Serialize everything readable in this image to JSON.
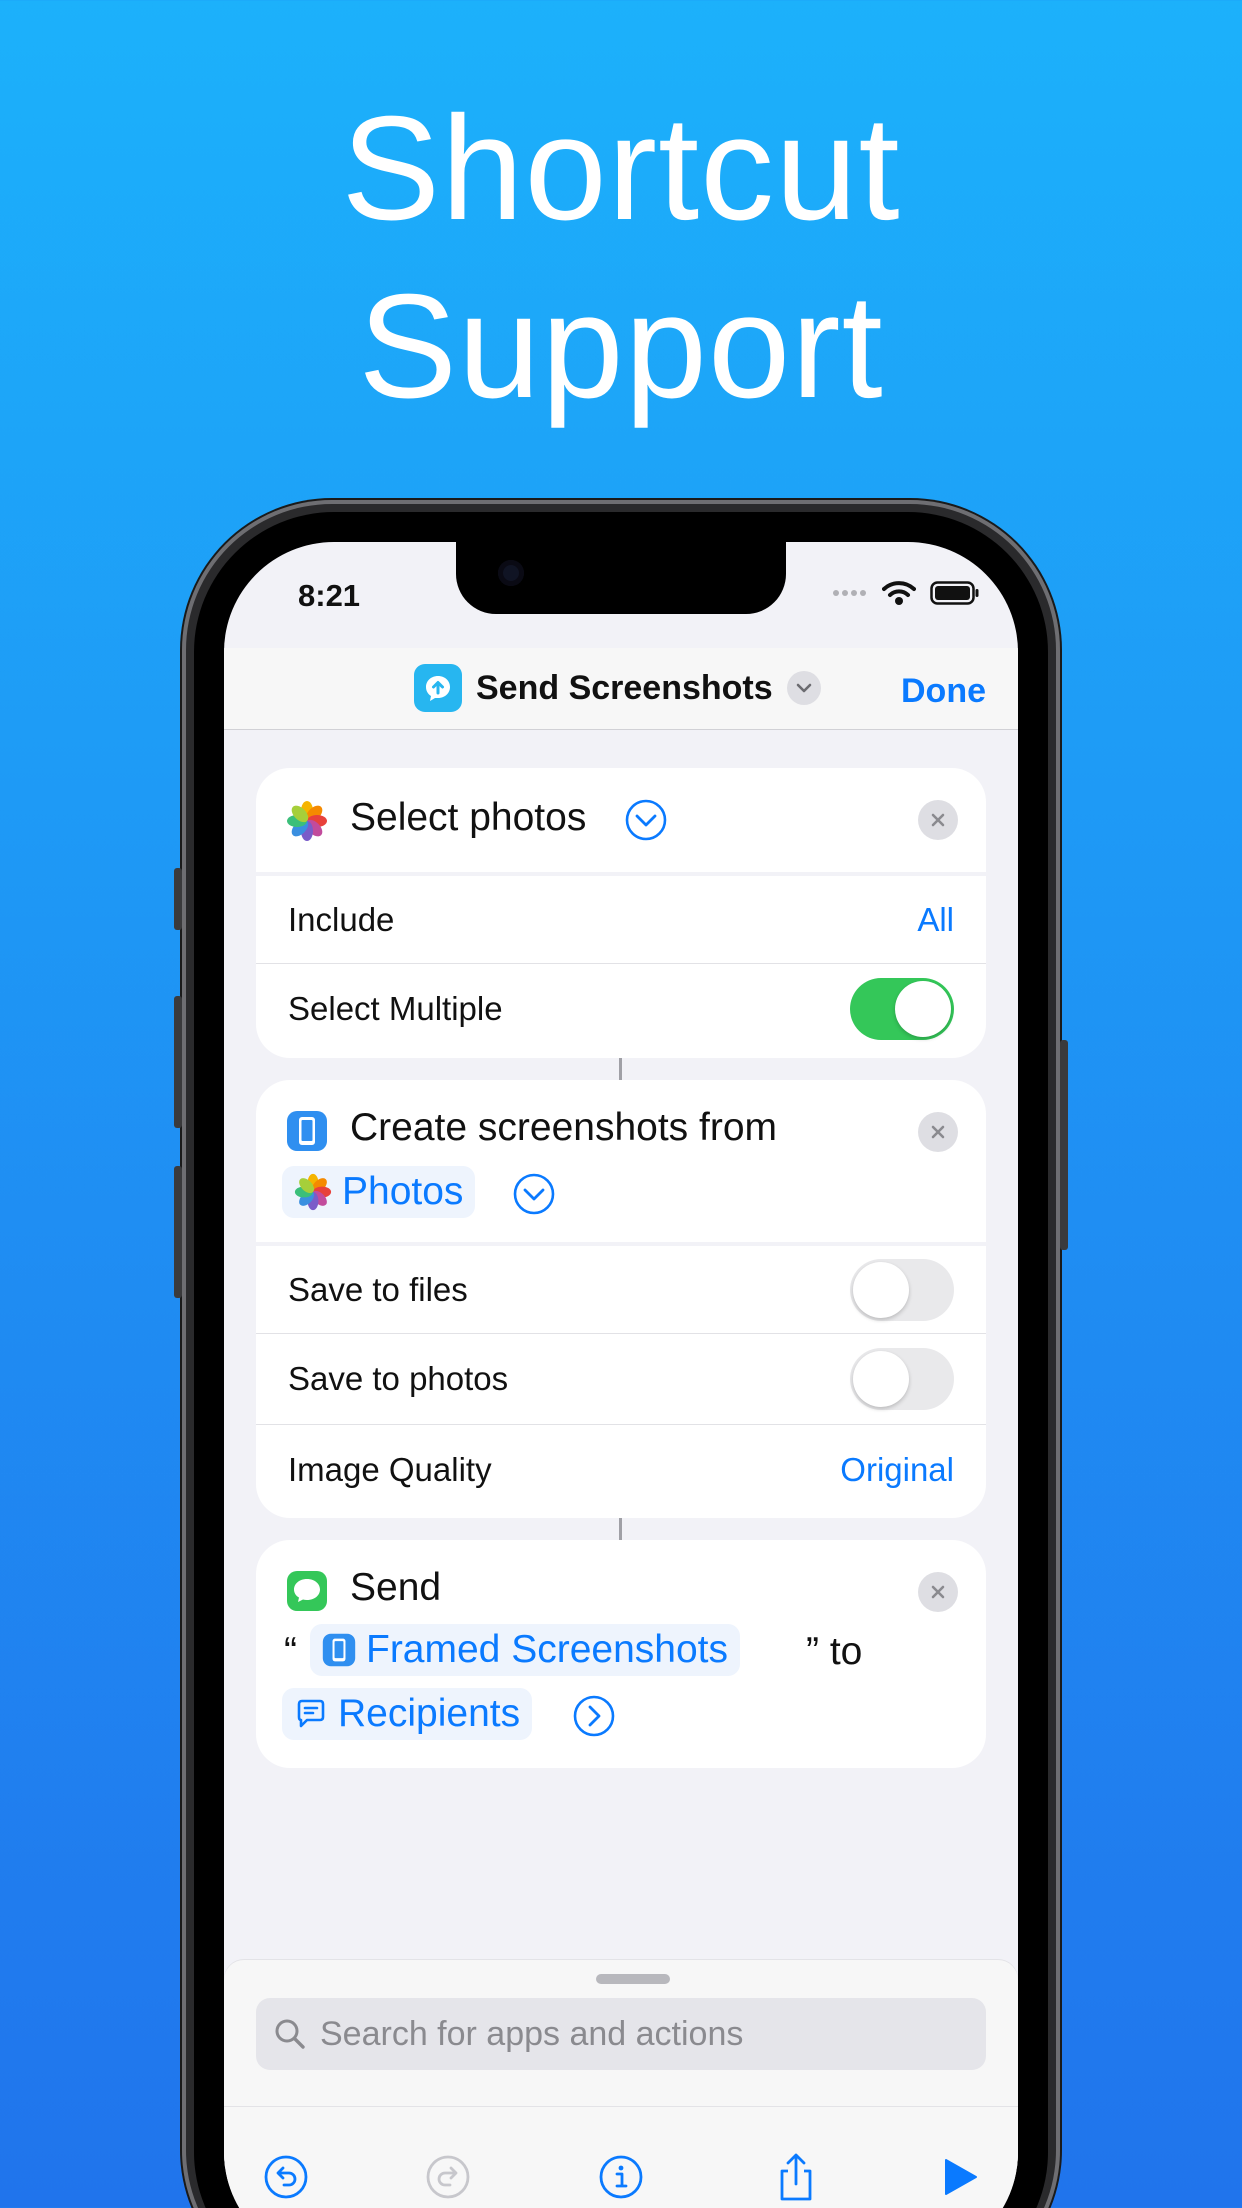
{
  "headline": {
    "line1": "Shortcut",
    "line2": "Support"
  },
  "status_bar": {
    "time": "8:21"
  },
  "nav": {
    "title": "Send Screenshots",
    "done_label": "Done"
  },
  "actions": {
    "select_photos": {
      "title": "Select photos",
      "include_label": "Include",
      "include_value": "All",
      "select_multiple_label": "Select Multiple",
      "select_multiple_on": true
    },
    "create_screenshots": {
      "title": "Create screenshots from",
      "source_token": "Photos",
      "save_to_files_label": "Save to files",
      "save_to_files_on": false,
      "save_to_photos_label": "Save to photos",
      "save_to_photos_on": false,
      "image_quality_label": "Image Quality",
      "image_quality_value": "Original"
    },
    "send": {
      "title": "Send",
      "open_quote": "“",
      "content_token": "Framed Screenshots",
      "close_quote_to": "” to",
      "recipients_token": "Recipients"
    }
  },
  "search": {
    "placeholder": "Search for apps and actions"
  },
  "toolbar": {
    "icons": [
      "undo-icon",
      "redo-icon",
      "info-icon",
      "share-icon",
      "play-icon"
    ]
  },
  "colors": {
    "background_top": "#1cb1fb",
    "background_bottom": "#2074ec",
    "accent": "#0a7aff",
    "toggle_on": "#34c759"
  }
}
